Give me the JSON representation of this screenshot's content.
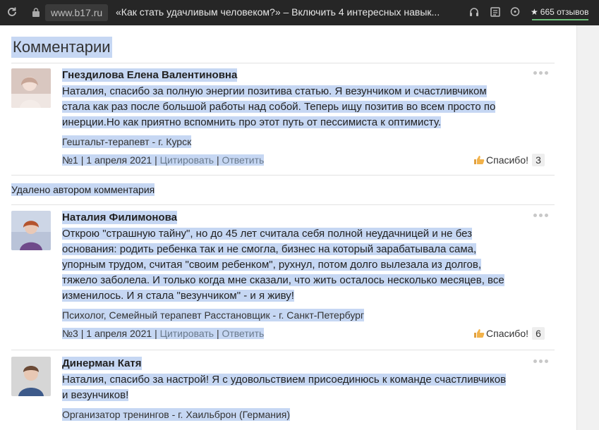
{
  "browser": {
    "reload_icon": "reload-icon",
    "url": "www.b17.ru",
    "tab_title": "«Как стать удачливым человеком?» – Включить 4 интересных навык...",
    "reviews": "665 отзывов",
    "toolbar_icons": [
      "headphones-icon",
      "reader-mode-icon",
      "chat-icon"
    ]
  },
  "section": {
    "title": "Комментарии"
  },
  "comments": [
    {
      "author": "Гнездилова Елена Валентиновна",
      "text_lines": [
        "Наталия, спасибо за полную энергии позитива статью. Я везунчиком и счастливчиком",
        "стала как раз после большой работы над собой. Теперь ищу позитив во всем просто по",
        "инерции.Но как приятно вспомнить про этот путь от пессимиста к оптимисту."
      ],
      "profession": "Гештальт-терапевт - г. Курск",
      "number": "№1",
      "date": "1 апреля 2021",
      "quote_label": "Цитировать",
      "reply_label": "Ответить",
      "thanks_label": "Спасибо!",
      "thanks_count": "3"
    },
    {
      "author": "Наталия Филимонова",
      "text_lines": [
        "Открою \"страшную тайну\", но до 45 лет считала себя полной неудачницей и не без",
        "основания: родить ребенка так и не смогла, бизнес на который зарабатывала сама,",
        "упорным трудом, считая \"своим ребенком\", рухнул, потом долго вылезала из долгов,",
        "тяжело заболела. И только когда мне сказали, что жить осталось несколько месяцев, все",
        "изменилось. И я стала \"везунчиком\" - и я живу!"
      ],
      "profession": "Психолог, Семейный терапевт Расстановщик - г. Санкт-Петербург",
      "number": "№3",
      "date": "1 апреля 2021",
      "quote_label": "Цитировать",
      "reply_label": "Ответить",
      "thanks_label": "Спасибо!",
      "thanks_count": "6"
    },
    {
      "author": "Динерман Катя",
      "text_lines": [
        "Наталия, спасибо за настрой! Я с удовольствием присоединюсь к команде счастливчиков",
        "и везунчиков!"
      ],
      "profession": "Организатор тренингов - г. Хаильброн (Германия)"
    }
  ],
  "deleted_notice": "Удалено автором комментария",
  "separator": "|"
}
